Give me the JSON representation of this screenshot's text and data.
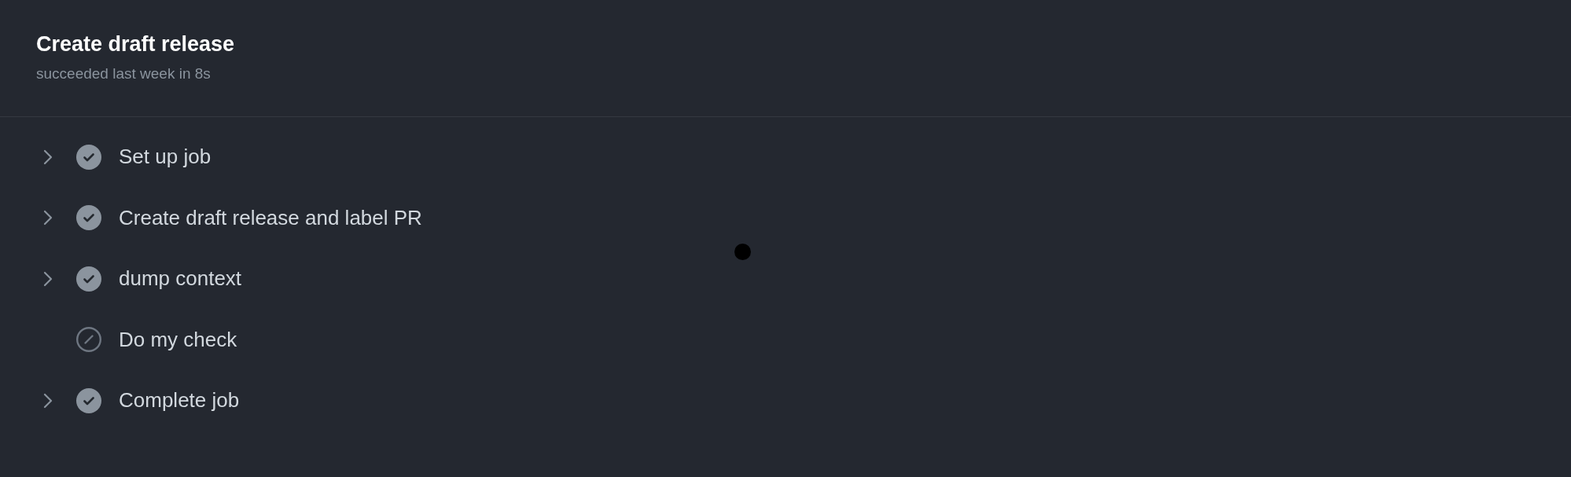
{
  "header": {
    "title": "Create draft release",
    "subtitle": "succeeded last week in 8s"
  },
  "steps": [
    {
      "label": "Set up job",
      "kind": "success"
    },
    {
      "label": "Create draft release and label PR",
      "kind": "success"
    },
    {
      "label": "dump context",
      "kind": "success"
    },
    {
      "label": "Do my check",
      "kind": "skipped"
    },
    {
      "label": "Complete job",
      "kind": "success"
    }
  ]
}
